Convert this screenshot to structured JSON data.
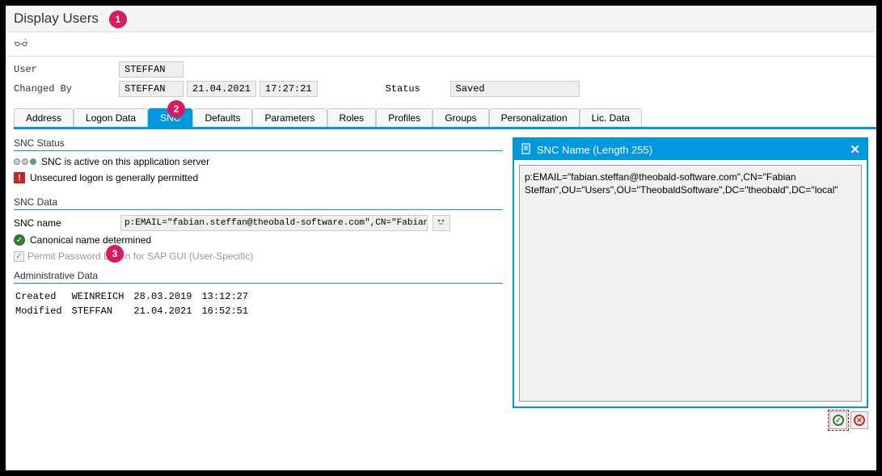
{
  "title": "Display Users",
  "callouts": {
    "c1": "1",
    "c2": "2",
    "c3": "3"
  },
  "form": {
    "user_label": "User",
    "user_value": "STEFFAN",
    "changed_by_label": "Changed By",
    "changed_by_value": "STEFFAN",
    "changed_date": "21.04.2021",
    "changed_time": "17:27:21",
    "status_label": "Status",
    "status_value": "Saved"
  },
  "tabs": [
    "Address",
    "Logon Data",
    "SNC",
    "Defaults",
    "Parameters",
    "Roles",
    "Profiles",
    "Groups",
    "Personalization",
    "Lic. Data"
  ],
  "active_tab": "SNC",
  "snc_status": {
    "title": "SNC Status",
    "line1": "SNC is active on this application server",
    "line2": "Unsecured logon is generally permitted"
  },
  "snc_data": {
    "title": "SNC Data",
    "name_label": "SNC name",
    "name_value": "p:EMAIL=\"fabian.steffan@theobald-software.com\",CN=\"Fabian Steffan\",OU=\"U...",
    "canonical": "Canonical name determined",
    "permit_label": "Permit Password Logon for SAP GUI (User-Specific)"
  },
  "admin": {
    "title": "Administrative Data",
    "created_label": "Created",
    "created_by": "WEINREICH",
    "created_date": "28.03.2019",
    "created_time": "13:12:27",
    "modified_label": "Modified",
    "modified_by": "STEFFAN",
    "modified_date": "21.04.2021",
    "modified_time": "16:52:51"
  },
  "popup": {
    "title": "SNC Name (Length 255)",
    "text": "p:EMAIL=\"fabian.steffan@theobald-software.com\",CN=\"Fabian Steffan\",OU=\"Users\",OU=\"TheobaldSoftware\",DC=\"theobald\",DC=\"local\""
  }
}
